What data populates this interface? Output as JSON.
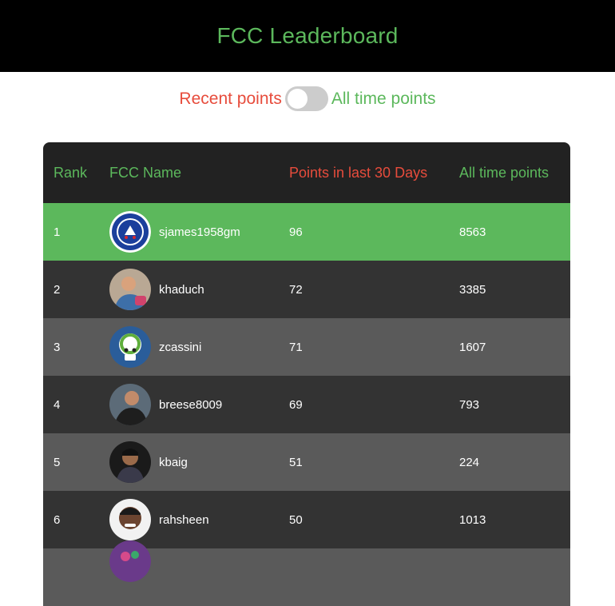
{
  "header": {
    "title": "FCC Leaderboard"
  },
  "toggle": {
    "left_label": "Recent points",
    "right_label": "All time points"
  },
  "table": {
    "columns": {
      "rank": "Rank",
      "name": "FCC Name",
      "recent": "Points in last 30 Days",
      "alltime": "All time points"
    },
    "rows": [
      {
        "rank": "1",
        "name": "sjames1958gm",
        "recent": "96",
        "alltime": "8563",
        "avatar": "chelsea-crest-avatar"
      },
      {
        "rank": "2",
        "name": "khaduch",
        "recent": "72",
        "alltime": "3385",
        "avatar": "user-photo-avatar"
      },
      {
        "rank": "3",
        "name": "zcassini",
        "recent": "71",
        "alltime": "1607",
        "avatar": "skull-logo-avatar"
      },
      {
        "rank": "4",
        "name": "breese8009",
        "recent": "69",
        "alltime": "793",
        "avatar": "user-photo-avatar"
      },
      {
        "rank": "5",
        "name": "kbaig",
        "recent": "51",
        "alltime": "224",
        "avatar": "user-photo-avatar"
      },
      {
        "rank": "6",
        "name": "rahsheen",
        "recent": "50",
        "alltime": "1013",
        "avatar": "user-photo-avatar"
      }
    ]
  },
  "colors": {
    "accent_green": "#5cb85c",
    "accent_red": "#e74c3c",
    "header_bg": "#000000",
    "table_head_bg": "#222222",
    "row_dark": "#333333",
    "row_light": "#5a5a5a"
  }
}
